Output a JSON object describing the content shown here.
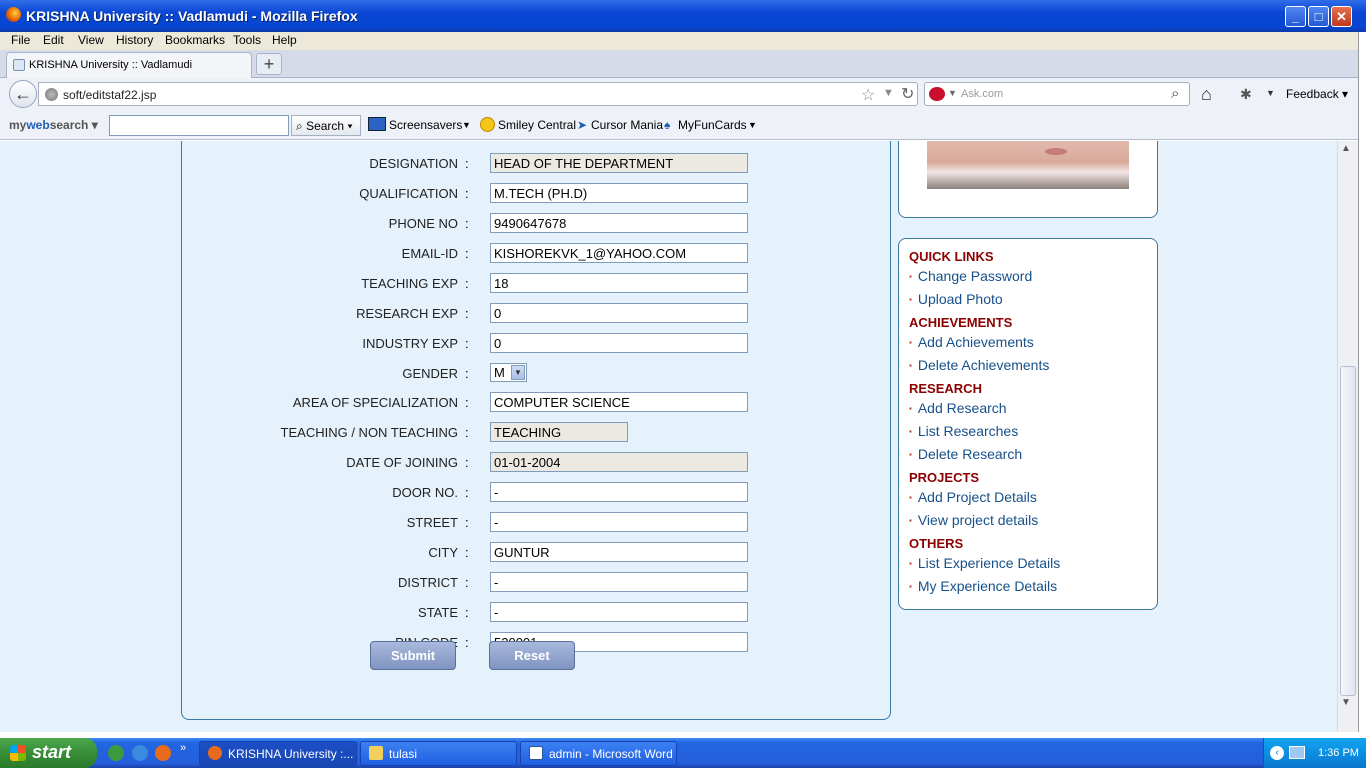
{
  "window": {
    "title": "KRISHNA University :: Vadlamudi - Mozilla Firefox"
  },
  "menu": [
    "File",
    "Edit",
    "View",
    "History",
    "Bookmarks",
    "Tools",
    "Help"
  ],
  "tab": {
    "label": "KRISHNA University :: Vadlamudi",
    "new_tab": "+"
  },
  "nav": {
    "url": "soft/editstaf22.jsp",
    "search_placeholder": "Ask.com",
    "feedback": "Feedback"
  },
  "toolbar": {
    "brand_a": "my",
    "brand_b": "web",
    "brand_c": "search",
    "search_button": "Search",
    "items": [
      "Screensavers",
      "Smiley Central",
      "Cursor Mania",
      "MyFunCards"
    ]
  },
  "form": {
    "rows": [
      {
        "label": "DESIGNATION",
        "value": "HEAD OF THE DEPARTMENT"
      },
      {
        "label": "QUALIFICATION",
        "value": "M.TECH (PH.D)"
      },
      {
        "label": "PHONE NO",
        "value": "9490647678"
      },
      {
        "label": "EMAIL-ID",
        "value": "KISHOREKVK_1@YAHOO.COM"
      },
      {
        "label": "TEACHING EXP",
        "value": "18"
      },
      {
        "label": "RESEARCH EXP",
        "value": "0"
      },
      {
        "label": "INDUSTRY EXP",
        "value": "0"
      },
      {
        "label": "GENDER",
        "value": "M"
      },
      {
        "label": "AREA OF SPECIALIZATION",
        "value": "COMPUTER SCIENCE"
      },
      {
        "label": "TEACHING / NON TEACHING",
        "value": "TEACHING"
      },
      {
        "label": "DATE OF JOINING",
        "value": "01-01-2004"
      },
      {
        "label": "DOOR NO.",
        "value": "-"
      },
      {
        "label": "STREET",
        "value": "-"
      },
      {
        "label": "CITY",
        "value": "GUNTUR"
      },
      {
        "label": "DISTRICT",
        "value": "-"
      },
      {
        "label": "STATE",
        "value": " -"
      },
      {
        "label": "PIN CODE",
        "value": "520001"
      }
    ],
    "colon": ":",
    "submit": "Submit",
    "reset": "Reset"
  },
  "sidebar": {
    "sections": [
      {
        "heading": "QUICK LINKS",
        "links": [
          "Change Password",
          "Upload Photo"
        ]
      },
      {
        "heading": "ACHIEVEMENTS",
        "links": [
          "Add Achievements",
          "Delete Achievements"
        ]
      },
      {
        "heading": "RESEARCH",
        "links": [
          "Add Research",
          "List Researches",
          "Delete Research"
        ]
      },
      {
        "heading": "PROJECTS",
        "links": [
          "Add Project Details",
          "View project details"
        ]
      },
      {
        "heading": "OTHERS",
        "links": [
          "List Experience Details",
          "My Experience Details"
        ]
      }
    ]
  },
  "taskbar": {
    "start": "start",
    "buttons": [
      "KRISHNA University :...",
      "tulasi",
      "admin - Microsoft Word"
    ],
    "clock": "1:36 PM"
  }
}
